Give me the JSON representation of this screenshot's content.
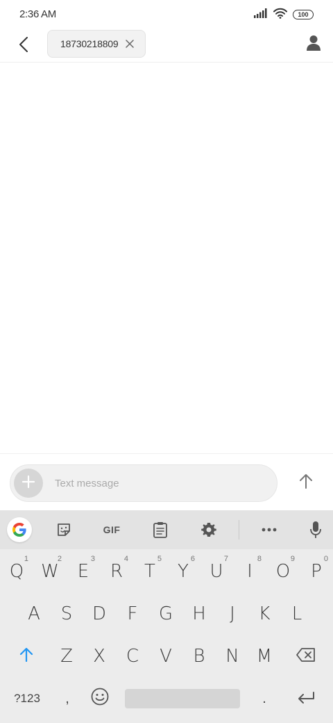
{
  "status_bar": {
    "time": "2:36 AM",
    "battery": "100",
    "icons": [
      "signal-icon",
      "wifi-icon",
      "battery-icon"
    ]
  },
  "header": {
    "back_icon": "back-arrow-icon",
    "recipient": "18730218809",
    "chip_close_icon": "close-icon",
    "contact_icon": "person-icon"
  },
  "compose": {
    "attach_icon": "plus-icon",
    "placeholder": "Text message",
    "value": "",
    "send_icon": "arrow-up-icon"
  },
  "keyboard": {
    "toolbar": {
      "items": [
        "google-icon",
        "sticker-icon",
        "GIF",
        "clipboard-icon",
        "gear-icon",
        "more-icon",
        "microphone-icon"
      ],
      "gif_label": "GIF"
    },
    "row1": [
      {
        "key": "Q",
        "hint": "1"
      },
      {
        "key": "W",
        "hint": "2"
      },
      {
        "key": "E",
        "hint": "3"
      },
      {
        "key": "R",
        "hint": "4"
      },
      {
        "key": "T",
        "hint": "5"
      },
      {
        "key": "Y",
        "hint": "6"
      },
      {
        "key": "U",
        "hint": "7"
      },
      {
        "key": "I",
        "hint": "8"
      },
      {
        "key": "O",
        "hint": "9"
      },
      {
        "key": "P",
        "hint": "0"
      }
    ],
    "row2": [
      "A",
      "S",
      "D",
      "F",
      "G",
      "H",
      "J",
      "K",
      "L"
    ],
    "row3": [
      "Z",
      "X",
      "C",
      "V",
      "B",
      "N",
      "M"
    ],
    "row4": {
      "symbols_label": "?123",
      "comma": ",",
      "period": "."
    },
    "colors": {
      "accent": "#2196F3",
      "background": "#ececec",
      "toolbar": "#e3e3e3"
    }
  }
}
